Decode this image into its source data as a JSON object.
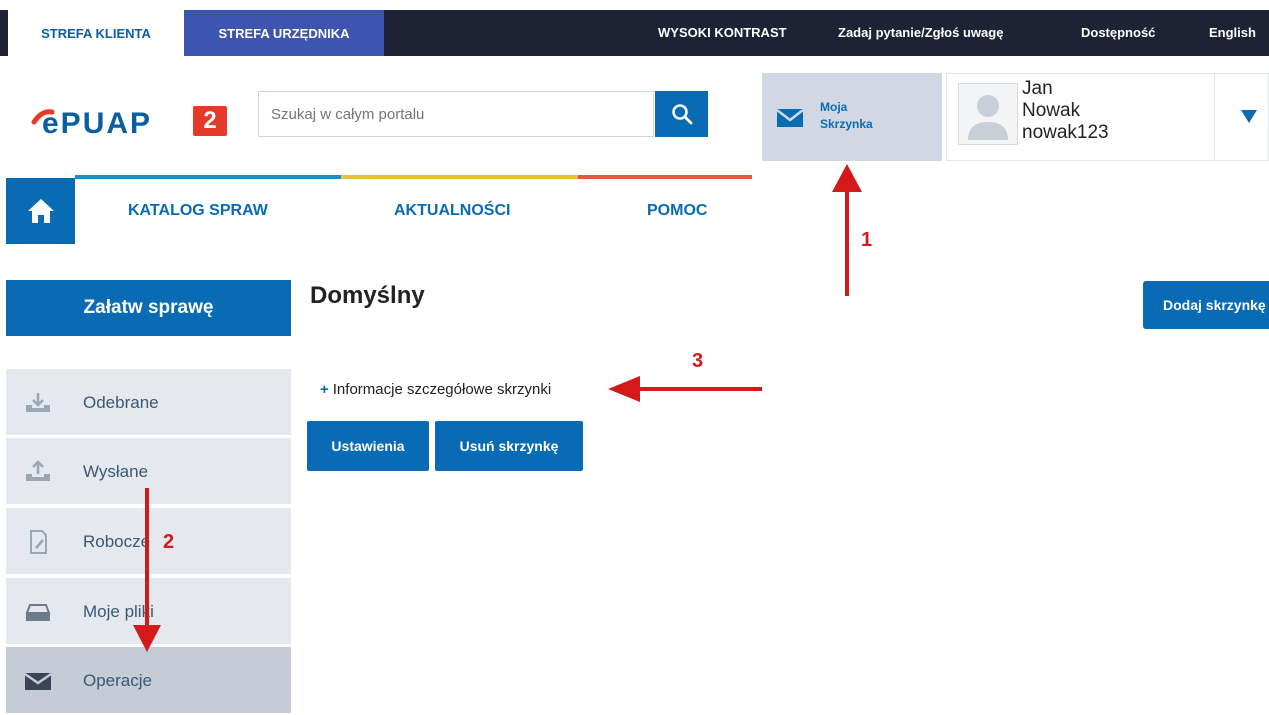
{
  "topbar": {
    "tab_client": "STREFA KLIENTA",
    "tab_official": "STREFA URZĘDNIKA",
    "high_contrast": "WYSOKI KONTRAST",
    "ask_question": "Zadaj pytanie/Zgłoś uwagę",
    "accessibility": "Dostępność",
    "language": "English"
  },
  "header": {
    "logo_text": "ePUAP",
    "logo_badge": "2",
    "search_placeholder": "Szukaj w całym portalu",
    "mailbox_line1": "Moja",
    "mailbox_line2": "Skrzynka",
    "user_first_name": "Jan",
    "user_last_name": "Nowak",
    "user_login": "nowak123"
  },
  "nav": {
    "items": [
      "KATALOG SPRAW",
      "AKTUALNOŚCI",
      "POMOC"
    ],
    "strip_colors": [
      "#1a8fd0",
      "#e8c13a",
      "#e05a3c"
    ]
  },
  "sidebar": {
    "action_button": "Załatw sprawę",
    "items": [
      {
        "label": "Odebrane",
        "icon": "inbox-download-icon"
      },
      {
        "label": "Wysłane",
        "icon": "outbox-upload-icon"
      },
      {
        "label": "Robocze",
        "icon": "draft-document-icon"
      },
      {
        "label": "Moje pliki",
        "icon": "files-tray-icon"
      },
      {
        "label": "Operacje",
        "icon": "envelope-icon"
      }
    ]
  },
  "main": {
    "title": "Domyślny",
    "info_link": "Informacje szczegółowe skrzynki",
    "settings_button": "Ustawienia",
    "delete_button": "Usuń skrzynkę",
    "add_button": "Dodaj skrzynkę"
  },
  "annotations": [
    "1",
    "2",
    "3"
  ],
  "colors": {
    "primary": "#0a6bb5",
    "topbar": "#1e2235",
    "official_tab": "#3e55b0",
    "annotation": "#d21a1a",
    "logo_red": "#e33a2a"
  }
}
